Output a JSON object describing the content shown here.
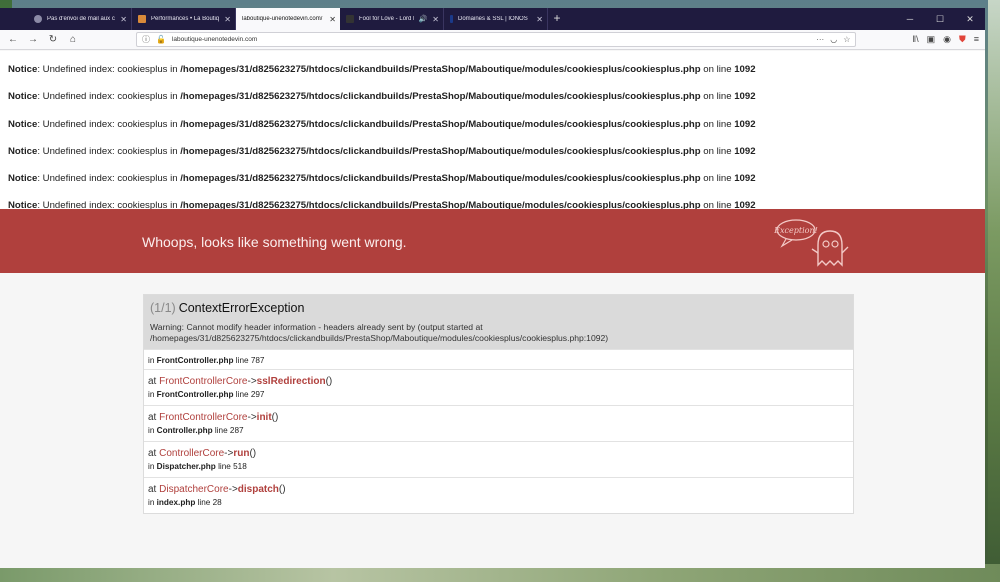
{
  "browser": {
    "tabs": [
      {
        "title": "Pas d'envoi de mail aux clients",
        "icon_color": "#7d7d9a",
        "active": false
      },
      {
        "title": "Performances • La Boutique Un",
        "icon_color": "#d98a3a",
        "active": false
      },
      {
        "title": "laboutique-unenotedevin.com/",
        "icon_color": "#ffffff",
        "active": true
      },
      {
        "title": "Fool for Love - Lord Huron",
        "icon_color": "#444",
        "active": false
      },
      {
        "title": "Domaines & SSL | IONOS",
        "icon_color": "#1b3a8a",
        "active": false
      }
    ],
    "new_tab_label": "+",
    "url": "laboutique-unenotedevin.com"
  },
  "notices": [
    {
      "label": "Notice",
      "message": ": Undefined index: cookiesplus in ",
      "path": "/homepages/31/d825623275/htdocs/clickandbuilds/PrestaShop/Maboutique/modules/cookiesplus/cookiesplus.php",
      "on_line": " on line ",
      "line": "1092"
    },
    {
      "label": "Notice",
      "message": ": Undefined index: cookiesplus in ",
      "path": "/homepages/31/d825623275/htdocs/clickandbuilds/PrestaShop/Maboutique/modules/cookiesplus/cookiesplus.php",
      "on_line": " on line ",
      "line": "1092"
    },
    {
      "label": "Notice",
      "message": ": Undefined index: cookiesplus in ",
      "path": "/homepages/31/d825623275/htdocs/clickandbuilds/PrestaShop/Maboutique/modules/cookiesplus/cookiesplus.php",
      "on_line": " on line ",
      "line": "1092"
    },
    {
      "label": "Notice",
      "message": ": Undefined index: cookiesplus in ",
      "path": "/homepages/31/d825623275/htdocs/clickandbuilds/PrestaShop/Maboutique/modules/cookiesplus/cookiesplus.php",
      "on_line": " on line ",
      "line": "1092"
    },
    {
      "label": "Notice",
      "message": ": Undefined index: cookiesplus in ",
      "path": "/homepages/31/d825623275/htdocs/clickandbuilds/PrestaShop/Maboutique/modules/cookiesplus/cookiesplus.php",
      "on_line": " on line ",
      "line": "1092"
    },
    {
      "label": "Notice",
      "message": ": Undefined index: cookiesplus in ",
      "path": "/homepages/31/d825623275/htdocs/clickandbuilds/PrestaShop/Maboutique/modules/cookiesplus/cookiesplus.php",
      "on_line": " on line ",
      "line": "1092"
    }
  ],
  "banner": {
    "text": "Whoops, looks like something went wrong.",
    "mascot_label": "Exception!",
    "color": "#b0403d"
  },
  "exception": {
    "count": "(1/1)",
    "name": "ContextErrorException",
    "message": "Warning: Cannot modify header information - headers already sent by (output started at /homepages/31/d825623275/htdocs/clickandbuilds/PrestaShop/Maboutique/modules/cookiesplus/cookiesplus.php:1092)",
    "first_frame": {
      "in": "in ",
      "file": "FrontController.php",
      "line": " line 787"
    },
    "frames": [
      {
        "at": "at ",
        "class": "FrontControllerCore",
        "arrow": "->",
        "method": "sslRedirection",
        "parens": "()",
        "in": "in ",
        "file": "FrontController.php",
        "line": " line 297"
      },
      {
        "at": "at ",
        "class": "FrontControllerCore",
        "arrow": "->",
        "method": "init",
        "parens": "()",
        "in": "in ",
        "file": "Controller.php",
        "line": " line 287"
      },
      {
        "at": "at ",
        "class": "ControllerCore",
        "arrow": "->",
        "method": "run",
        "parens": "()",
        "in": "in ",
        "file": "Dispatcher.php",
        "line": " line 518"
      },
      {
        "at": "at ",
        "class": "DispatcherCore",
        "arrow": "->",
        "method": "dispatch",
        "parens": "()",
        "in": "in ",
        "file": "index.php",
        "line": " line 28"
      }
    ]
  }
}
